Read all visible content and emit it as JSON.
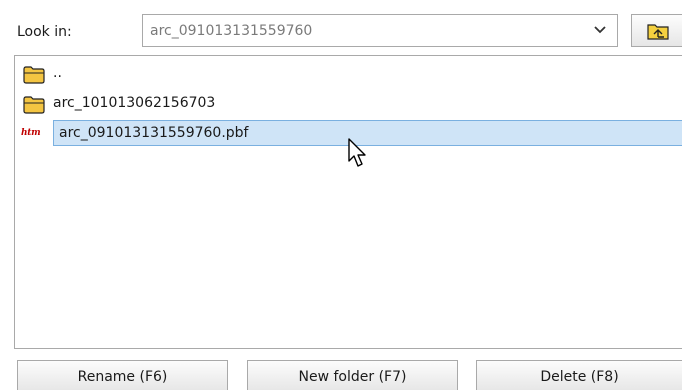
{
  "look_in": {
    "label": "Look in:",
    "value": "arc_091013131559760"
  },
  "toolbar": {
    "up_icon": "folder-up-icon"
  },
  "file_list": {
    "items": [
      {
        "name": "..",
        "icon": "folder-icon",
        "selected": false
      },
      {
        "name": "arc_101013062156703",
        "icon": "folder-icon",
        "selected": false
      },
      {
        "name": "arc_091013131559760.pbf",
        "icon": "htm-file-icon",
        "badge": "htm",
        "selected": true
      }
    ]
  },
  "buttons": {
    "rename": "Rename (F6)",
    "new_folder": "New folder (F7)",
    "delete": "Delete (F8)"
  },
  "colors": {
    "selection_fill": "#cfe4f7",
    "selection_border": "#7ab0e0",
    "folder_fill": "#f4c542",
    "badge_red": "#c00000"
  }
}
